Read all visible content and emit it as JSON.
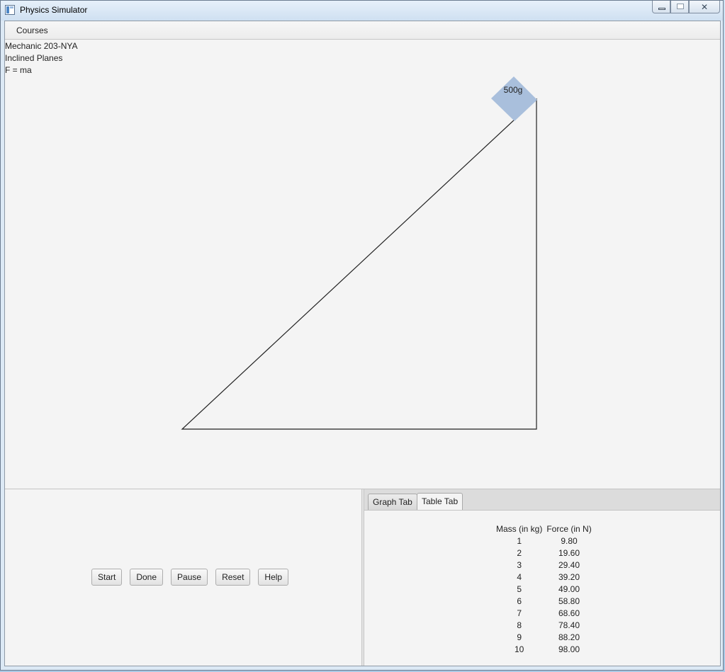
{
  "window": {
    "title": "Physics Simulator",
    "minimize_glyph": "—",
    "maximize_glyph": "□",
    "close_glyph": "✕"
  },
  "menubar": {
    "courses_label": "Courses"
  },
  "info": {
    "course": "Mechanic 203-NYA",
    "topic": "Inclined Planes",
    "formula": "F = ma"
  },
  "simulation": {
    "block_label": "500g",
    "block_color": "#a9bfdc",
    "line_color": "#222222"
  },
  "controls": {
    "start": "Start",
    "done": "Done",
    "pause": "Pause",
    "reset": "Reset",
    "help": "Help"
  },
  "tabs": {
    "graph": "Graph Tab",
    "table": "Table Tab",
    "active": "table"
  },
  "table": {
    "headers": [
      "Mass (in kg)",
      "Force (in N)"
    ],
    "rows": [
      [
        "1",
        "9.80"
      ],
      [
        "2",
        "19.60"
      ],
      [
        "3",
        "29.40"
      ],
      [
        "4",
        "39.20"
      ],
      [
        "5",
        "49.00"
      ],
      [
        "6",
        "58.80"
      ],
      [
        "7",
        "68.60"
      ],
      [
        "8",
        "78.40"
      ],
      [
        "9",
        "88.20"
      ],
      [
        "10",
        "98.00"
      ]
    ]
  }
}
